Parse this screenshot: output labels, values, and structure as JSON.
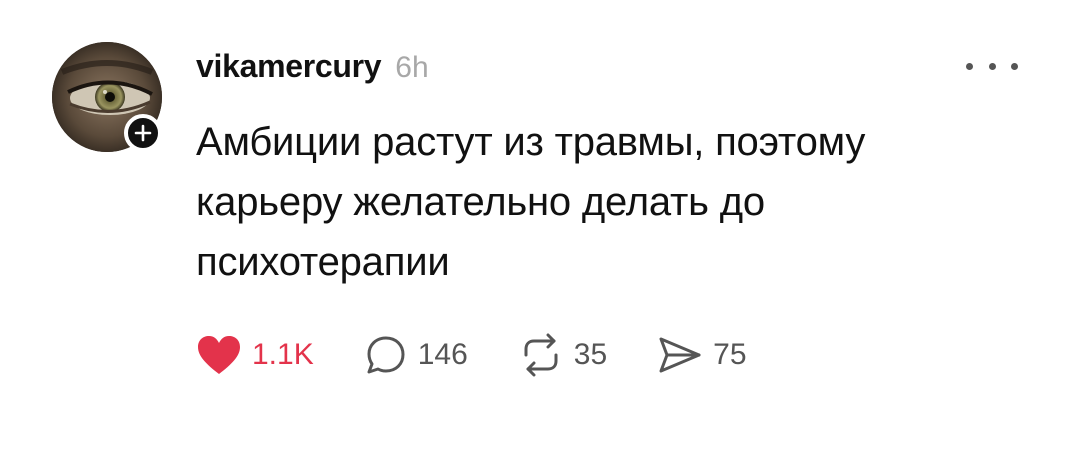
{
  "post": {
    "username": "vikamercury",
    "time": "6h",
    "text": "Амбиции растут из травмы, поэтому\nкарьеру желательно делать до\nпсихотерапии",
    "avatar_icon": "eye-avatar",
    "follow_icon": "plus-icon",
    "more_icon": "more-dots-icon"
  },
  "actions": {
    "like": {
      "icon": "heart-icon",
      "count": "1.1K",
      "color": "#e3334b",
      "liked": true
    },
    "reply": {
      "icon": "comment-icon",
      "count": "146"
    },
    "repost": {
      "icon": "repost-icon",
      "count": "35"
    },
    "share": {
      "icon": "send-icon",
      "count": "75"
    }
  },
  "colors": {
    "accent_like": "#e3334b",
    "text_primary": "#111111",
    "text_secondary": "#a8a8a8",
    "icon": "#555555"
  }
}
